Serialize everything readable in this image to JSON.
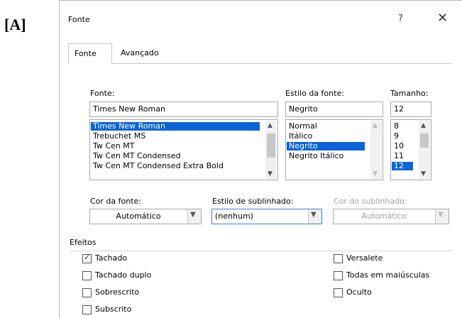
{
  "tag_label": "[A]",
  "window": {
    "title": "Fonte",
    "help_label": "?",
    "close_label": "✕"
  },
  "tabs": [
    {
      "label": "Fonte",
      "active": true
    },
    {
      "label": "Avançado",
      "active": false
    }
  ],
  "font": {
    "label": "Fonte:",
    "value": "Times New Roman",
    "options": [
      "Times New Roman",
      "Trebuchet MS",
      "Tw Cen MT",
      "Tw Cen MT Condensed",
      "Tw Cen MT Condensed Extra Bold"
    ],
    "selected_index": 0
  },
  "style": {
    "label": "Estilo da fonte:",
    "value": "Negrito",
    "options": [
      "Normal",
      "Itálico",
      "Negrito",
      "Negrito Itálico"
    ],
    "selected_index": 2
  },
  "size": {
    "label": "Tamanho:",
    "value": "12",
    "options": [
      "8",
      "9",
      "10",
      "11",
      "12"
    ],
    "selected_index": 4
  },
  "font_color": {
    "label": "Cor da fonte:",
    "value": "Automático"
  },
  "underline_style": {
    "label": "Estilo de sublinhado:",
    "value": "(nenhum)"
  },
  "underline_color": {
    "label": "Cor do sublinhado:",
    "value": "Automático"
  },
  "effects": {
    "label": "Efeitos",
    "items": [
      {
        "label": "Tachado",
        "checked": true
      },
      {
        "label": "Tachado duplo",
        "checked": false
      },
      {
        "label": "Sobrescrito",
        "checked": false
      },
      {
        "label": "Subscrito",
        "checked": false
      },
      {
        "label": "Versalete",
        "checked": false
      },
      {
        "label": "Todas em maiúsculas",
        "checked": false
      },
      {
        "label": "Oculto",
        "checked": false
      }
    ]
  },
  "icons": {
    "scroll_up": "▲",
    "scroll_down": "▼",
    "dropdown": "▼",
    "check": "✓"
  },
  "colors": {
    "selection": "#0a64d8",
    "focus_border": "#4a7ad0"
  }
}
